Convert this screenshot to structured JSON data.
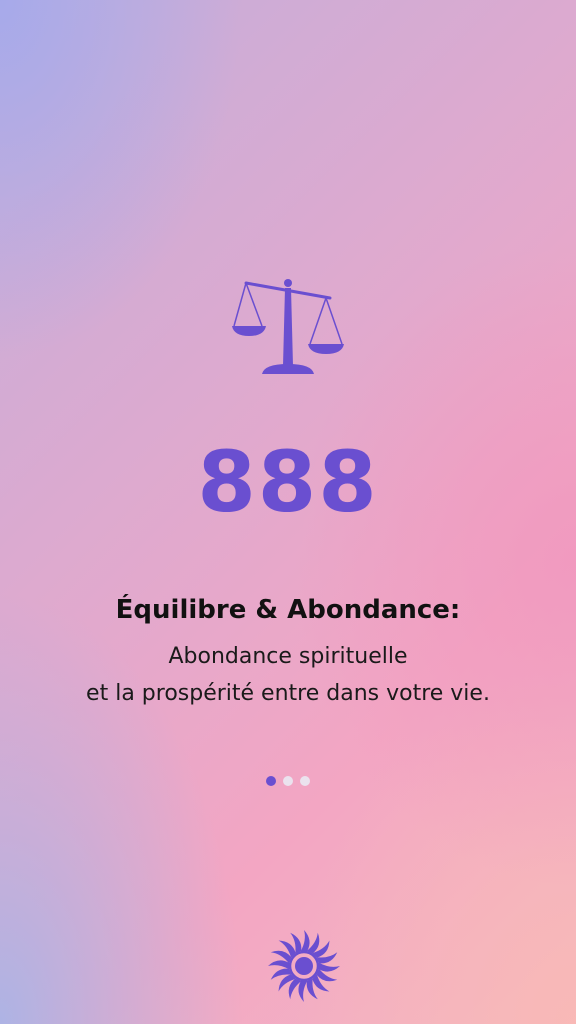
{
  "hero": {
    "icon": "balance-scale-icon",
    "number": "888",
    "accent_color": "#6a4fd0"
  },
  "content": {
    "title": "Équilibre & Abondance:",
    "line1": "Abondance spirituelle",
    "line2": "et la prospérité entre dans votre vie."
  },
  "pager": {
    "total": 3,
    "active_index": 0,
    "active_color": "#6a4fd0",
    "inactive_color": "#ebe2ee"
  },
  "footer": {
    "icon": "sun-icon"
  }
}
